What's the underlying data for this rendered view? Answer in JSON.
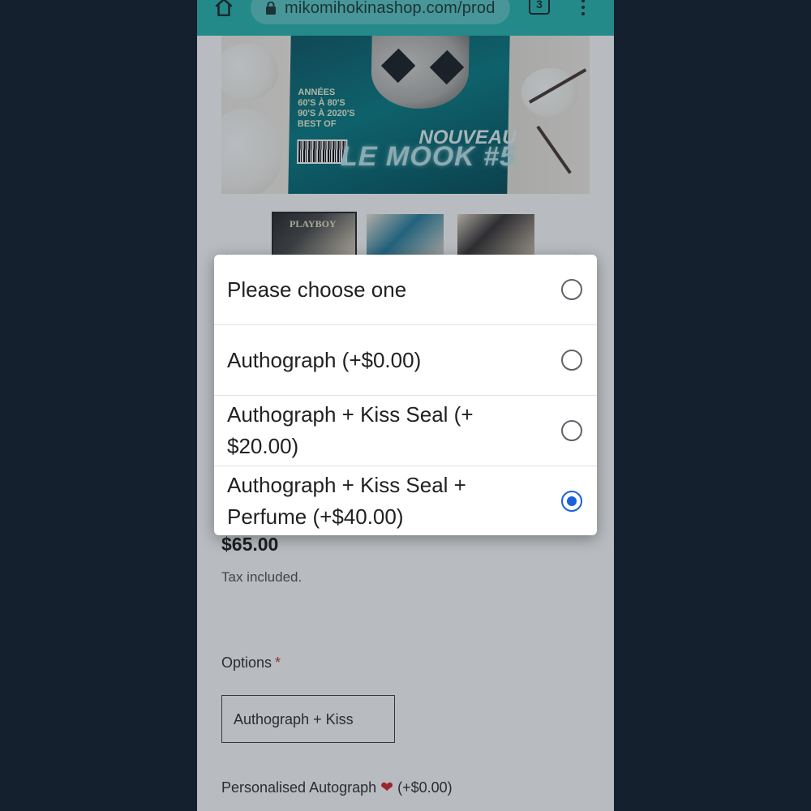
{
  "browser": {
    "url": "mikomihokinashop.com/prod",
    "tab_count": "3"
  },
  "product": {
    "image_text": {
      "years": [
        "ANNÉES",
        "60'S À 80'S",
        "90'S À 2020'S",
        "BEST OF"
      ],
      "new": "NOUVEAU",
      "title": "LE MOOK #5"
    },
    "thumbnail_text": "PLAYBOY",
    "price": "$65.00",
    "tax_note": "Tax included.",
    "options_label": "Options",
    "options_required_marker": "*",
    "options_selected_display": "Authograph + Kiss",
    "personalised_label": "Personalised Autograph",
    "personalised_price": "(+$0.00)"
  },
  "dialog": {
    "options": [
      {
        "label": "Please choose one",
        "selected": false
      },
      {
        "label": "Authograph (+$0.00)",
        "selected": false
      },
      {
        "label": "Authograph + Kiss Seal (+ $20.00)",
        "selected": false
      },
      {
        "label": "Authograph + Kiss Seal + Perfume (+$40.00)",
        "selected": true
      }
    ]
  },
  "colors": {
    "browser_bar": "#2bb6b0",
    "page_background": "#14202d",
    "radio_selected": "#1a62d6",
    "required_marker": "#c0392b"
  }
}
